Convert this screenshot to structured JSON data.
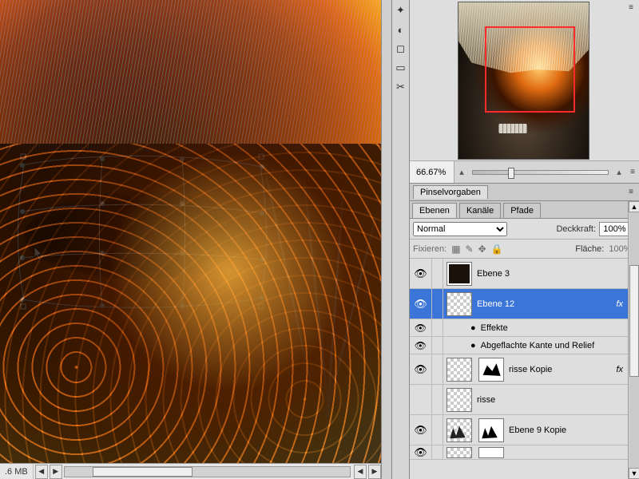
{
  "status_bar": {
    "file_size": ".6 MB"
  },
  "tool_strip": {
    "tools": [
      "brush-alt-icon",
      "droplet-icon",
      "camera-icon",
      "ruler-icon",
      "wrench-icon"
    ]
  },
  "navigator": {
    "zoom": "66.67%",
    "marquee_note": "viewport-rect"
  },
  "brush_presets": {
    "tab_label": "Pinselvorgaben"
  },
  "layers_panel": {
    "tabs": {
      "layers": "Ebenen",
      "channels": "Kanäle",
      "paths": "Pfade"
    },
    "blend_mode": "Normal",
    "opacity_label": "Deckkraft:",
    "opacity_value": "100%",
    "lock_label": "Fixieren:",
    "fill_label": "Fläche:",
    "fill_value": "100%",
    "effects_label": "Effekte",
    "bevel_label": "Abgeflachte Kante und Relief",
    "layers": [
      {
        "name": "Ebene 3",
        "visible": true,
        "locked": true,
        "fx": false,
        "thumb": "solid"
      },
      {
        "name": "Ebene 12",
        "visible": true,
        "selected": true,
        "fx": true,
        "thumb": "transp"
      },
      {
        "name": "risse Kopie",
        "visible": true,
        "fx": true,
        "thumb": "shape1",
        "mask": true
      },
      {
        "name": "risse",
        "visible": false,
        "fx": false,
        "thumb": "transp"
      },
      {
        "name": "Ebene 9 Kopie",
        "visible": true,
        "fx": false,
        "thumb": "shape2",
        "mask": true
      }
    ]
  }
}
